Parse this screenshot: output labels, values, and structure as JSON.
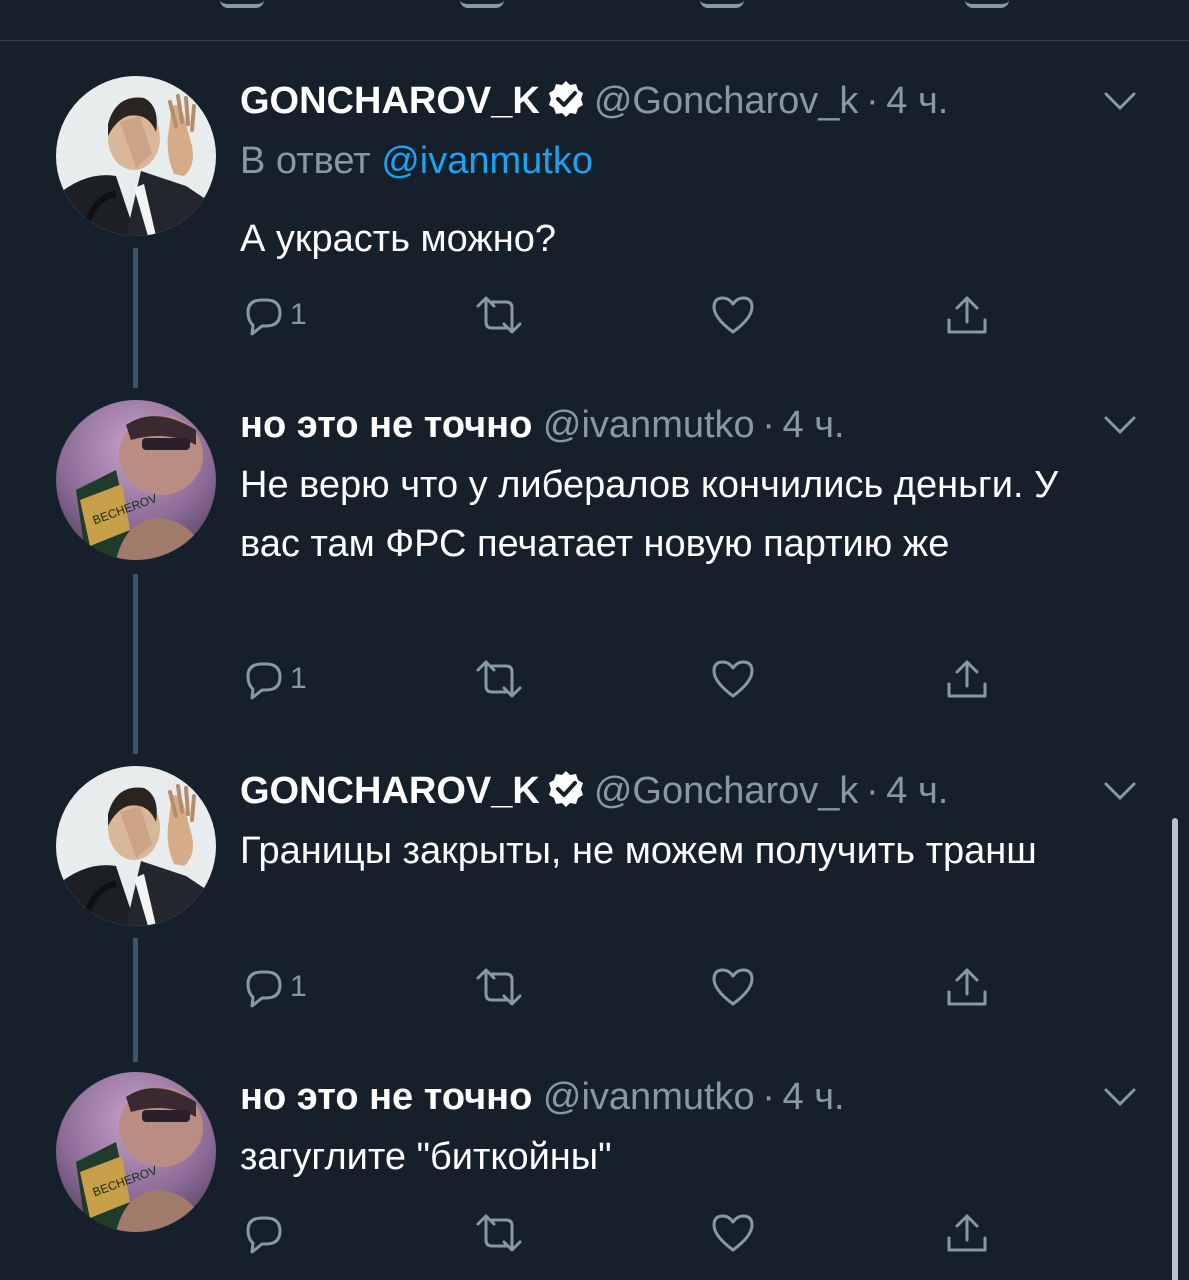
{
  "colors": {
    "background": "#15202b",
    "secondary_text": "#8899a6",
    "link": "#1da1f2",
    "thread_line": "#3d5466",
    "divider": "#38444d"
  },
  "icons": {
    "reply": "speech-bubble-icon",
    "retweet": "retweet-icon",
    "like": "heart-icon",
    "share": "share-icon",
    "verified": "verified-badge-icon",
    "menu": "chevron-down-icon"
  },
  "tweets": [
    {
      "display_name": "GONCHAROV_K",
      "handle": "@Goncharov_k",
      "separator": "·",
      "time": "4 ч.",
      "verified": true,
      "reply_prefix": "В ответ",
      "reply_to": "@ivanmutko",
      "text": "А украсть можно?",
      "reply_count": "1"
    },
    {
      "display_name": "но это не точно",
      "handle": "@ivanmutko",
      "separator": "·",
      "time": "4 ч.",
      "verified": false,
      "text": "Не верю что у либералов кончились деньги. У вас там ФРС печатает новую партию же",
      "reply_count": "1"
    },
    {
      "display_name": "GONCHAROV_K",
      "handle": "@Goncharov_k",
      "separator": "·",
      "time": "4 ч.",
      "verified": true,
      "text": "Границы закрыты, не можем получить транш",
      "reply_count": "1"
    },
    {
      "display_name": "но это не точно",
      "handle": "@ivanmutko",
      "separator": "·",
      "time": "4 ч.",
      "verified": false,
      "text": "загуглите \"биткойны\"",
      "reply_count": ""
    }
  ]
}
